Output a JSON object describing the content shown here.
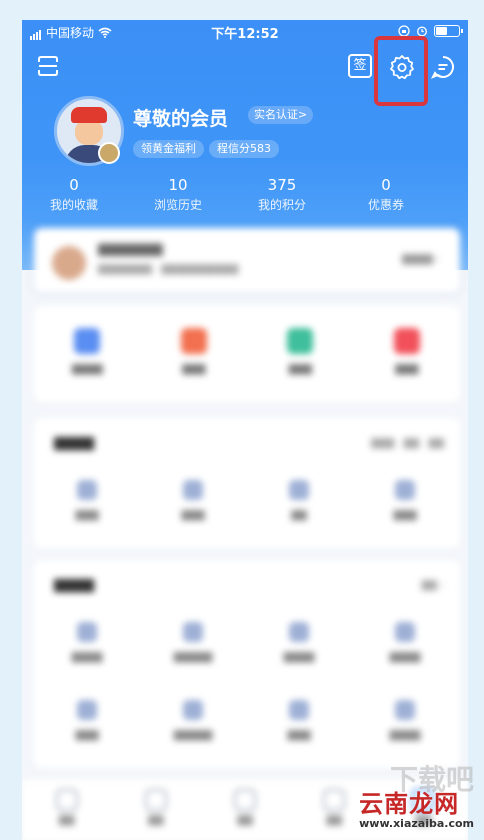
{
  "status_bar": {
    "carrier": "中国移动",
    "time": "下午12:52"
  },
  "header": {
    "sign_label": "签"
  },
  "profile": {
    "name": "尊敬的会员",
    "verify": "实名认证>",
    "welfare": "领黄金福利",
    "credit": "程信分583"
  },
  "stats": [
    {
      "value": "0",
      "label": "我的收藏"
    },
    {
      "value": "10",
      "label": "浏览历史"
    },
    {
      "value": "375",
      "label": "我的积分"
    },
    {
      "value": "0",
      "label": "优惠券"
    }
  ],
  "colors": {
    "accent": "#3b8ff6",
    "highlight": "#d9363e"
  },
  "watermark": {
    "brand": "云南龙网",
    "site": "www.xiazaiba.com",
    "ghost": "下载吧"
  }
}
